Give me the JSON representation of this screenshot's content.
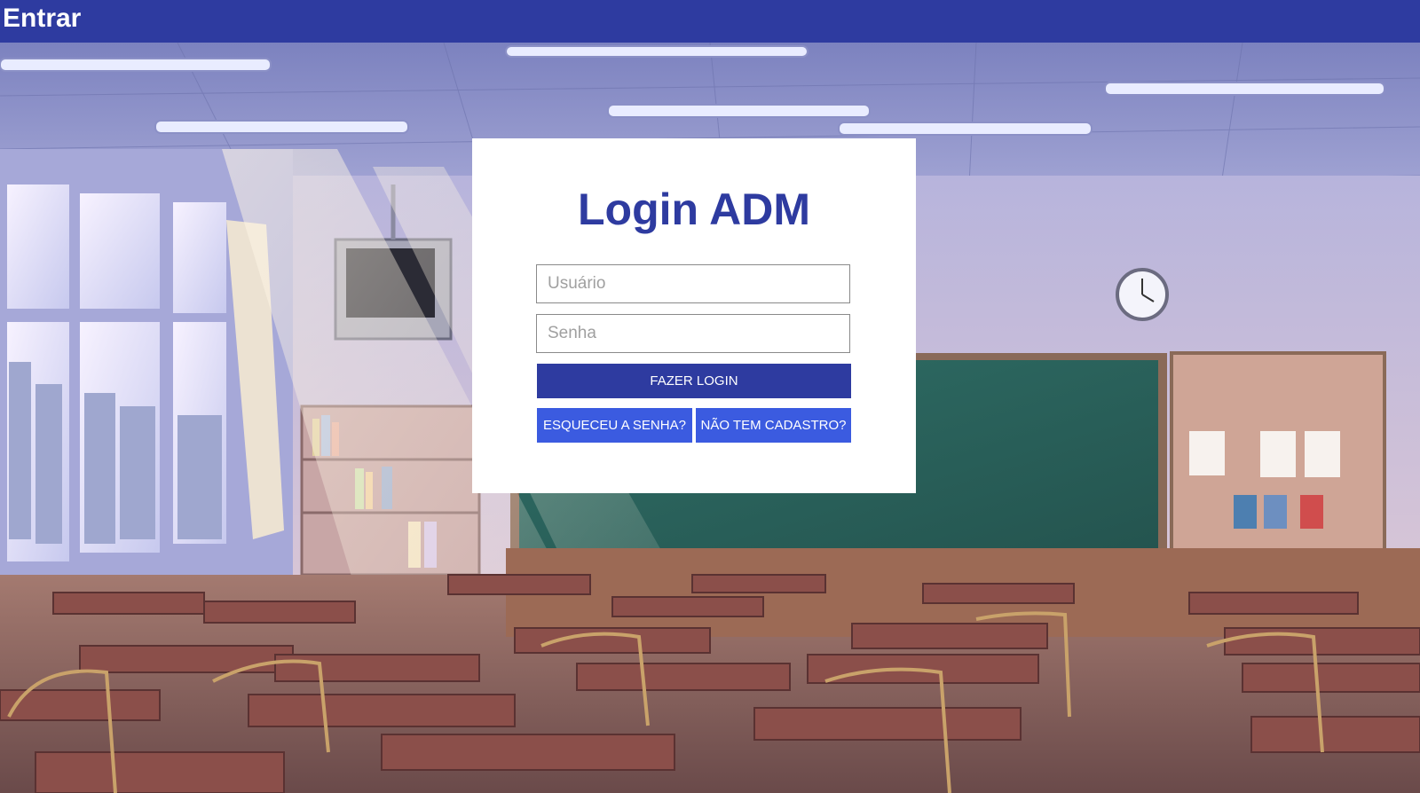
{
  "header": {
    "title": "Entrar"
  },
  "login": {
    "title": "Login ADM",
    "username_placeholder": "Usuário",
    "password_placeholder": "Senha",
    "submit_label": "FAZER LOGIN",
    "forgot_label": "ESQUECEU A SENHA?",
    "signup_label": "NÃO TEM CADASTRO?"
  },
  "colors": {
    "brand": "#2e3ba0",
    "secondary_button": "#3b5be0",
    "card_background": "#ffffff"
  }
}
